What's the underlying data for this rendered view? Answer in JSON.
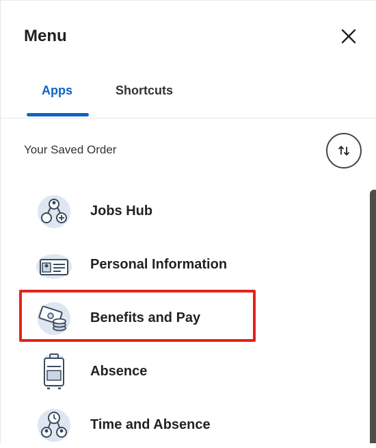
{
  "menu": {
    "title": "Menu",
    "close_icon": "close-icon"
  },
  "tabs": [
    {
      "label": "Apps",
      "active": true
    },
    {
      "label": "Shortcuts",
      "active": false
    }
  ],
  "section": {
    "label": "Your Saved Order",
    "sort_icon": "sort-arrows-icon"
  },
  "apps": [
    {
      "label": "Jobs Hub",
      "icon": "jobs-hub-icon"
    },
    {
      "label": "Personal Information",
      "icon": "id-card-icon"
    },
    {
      "label": "Benefits and Pay",
      "icon": "money-coins-icon",
      "highlighted": true
    },
    {
      "label": "Absence",
      "icon": "luggage-icon"
    },
    {
      "label": "Time and Absence",
      "icon": "people-clock-icon"
    }
  ],
  "colors": {
    "accent": "#0d63c4",
    "highlight": "#e2231a",
    "icon_bg": "#dde6f1",
    "icon_stroke": "#3b4a5c"
  }
}
